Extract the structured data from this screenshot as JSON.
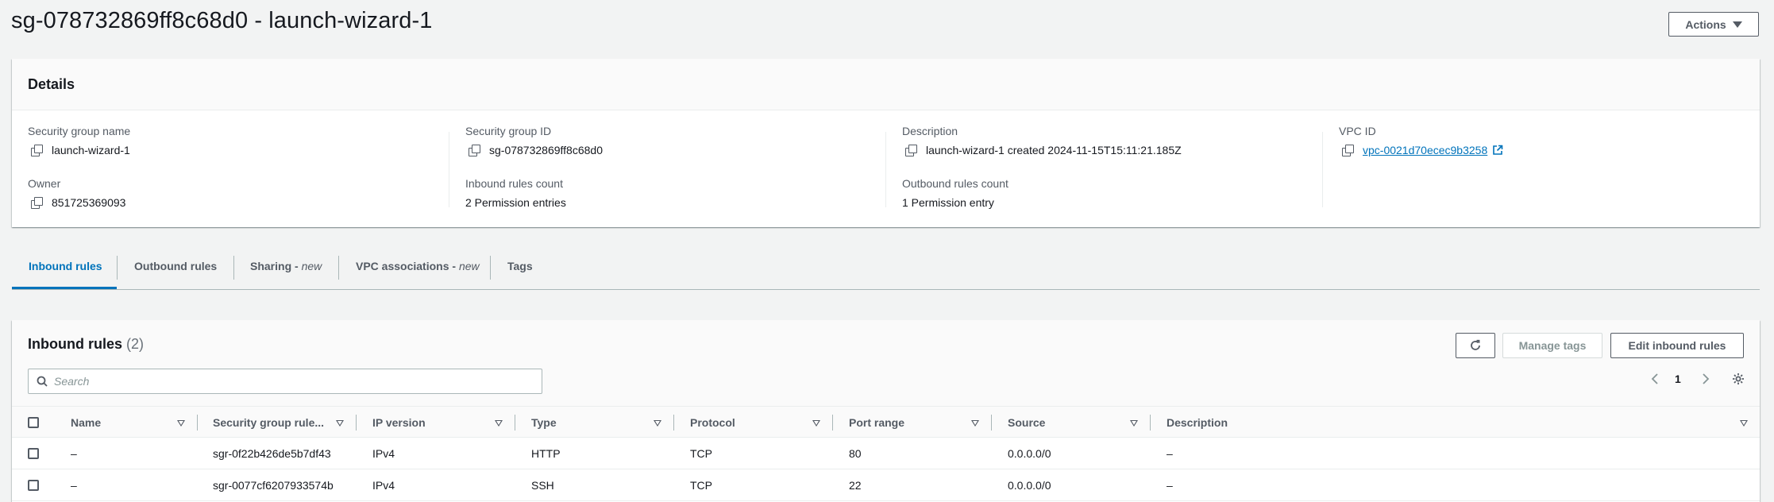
{
  "page": {
    "title": "sg-078732869ff8c68d0 - launch-wizard-1",
    "actions_label": "Actions"
  },
  "details": {
    "title": "Details",
    "fields": {
      "sg_name": {
        "label": "Security group name",
        "value": "launch-wizard-1"
      },
      "sg_id": {
        "label": "Security group ID",
        "value": "sg-078732869ff8c68d0"
      },
      "description": {
        "label": "Description",
        "value": "launch-wizard-1 created 2024-11-15T15:11:21.185Z"
      },
      "vpc_id": {
        "label": "VPC ID",
        "value": "vpc-0021d70ecec9b3258"
      },
      "owner": {
        "label": "Owner",
        "value": "851725369093"
      },
      "inbound_count": {
        "label": "Inbound rules count",
        "value": "2 Permission entries"
      },
      "outbound_count": {
        "label": "Outbound rules count",
        "value": "1 Permission entry"
      }
    }
  },
  "tabs": [
    {
      "label": "Inbound rules",
      "suffix": "",
      "active": true
    },
    {
      "label": "Outbound rules",
      "suffix": ""
    },
    {
      "label": "Sharing - ",
      "suffix": "new"
    },
    {
      "label": "VPC associations - ",
      "suffix": "new"
    },
    {
      "label": "Tags",
      "suffix": ""
    }
  ],
  "inbound": {
    "title": "Inbound rules",
    "count": "(2)",
    "manage_tags_label": "Manage tags",
    "edit_label": "Edit inbound rules",
    "search_placeholder": "Search",
    "page_number": "1",
    "columns": [
      "Name",
      "Security group rule...",
      "IP version",
      "Type",
      "Protocol",
      "Port range",
      "Source",
      "Description"
    ],
    "rows": [
      {
        "name": "–",
        "rule_id": "sgr-0f22b426de5b7df43",
        "ip_version": "IPv4",
        "type": "HTTP",
        "protocol": "TCP",
        "port_range": "80",
        "source": "0.0.0.0/0",
        "description": "–"
      },
      {
        "name": "–",
        "rule_id": "sgr-0077cf6207933574b",
        "ip_version": "IPv4",
        "type": "SSH",
        "protocol": "TCP",
        "port_range": "22",
        "source": "0.0.0.0/0",
        "description": "–"
      }
    ]
  },
  "colors": {
    "link": "#0073bb",
    "text": "#16191f",
    "muted": "#545b64",
    "background": "#f2f3f3"
  }
}
